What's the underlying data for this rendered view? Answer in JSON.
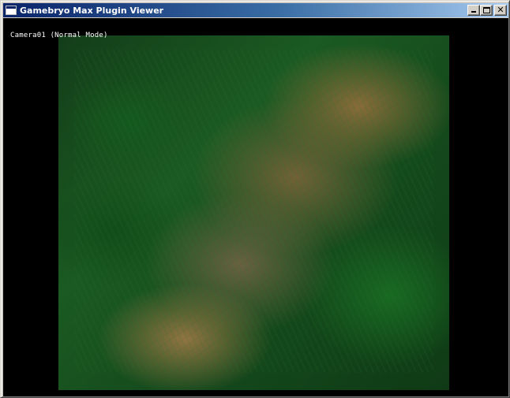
{
  "window": {
    "title": "Gamebryo Max Plugin Viewer"
  },
  "icons": {
    "app": "app-window-icon",
    "minimize": "minimize-icon",
    "maximize": "maximize-icon",
    "close": "close-icon"
  },
  "caption_buttons": {
    "close_glyph": "✕"
  },
  "viewport": {
    "camera_label": "Camera01 (Normal Mode)"
  },
  "colors": {
    "titlebar_start": "#0a246a",
    "titlebar_end": "#a6caf0",
    "viewport_background": "#000000",
    "chrome": "#d4d0c8"
  }
}
